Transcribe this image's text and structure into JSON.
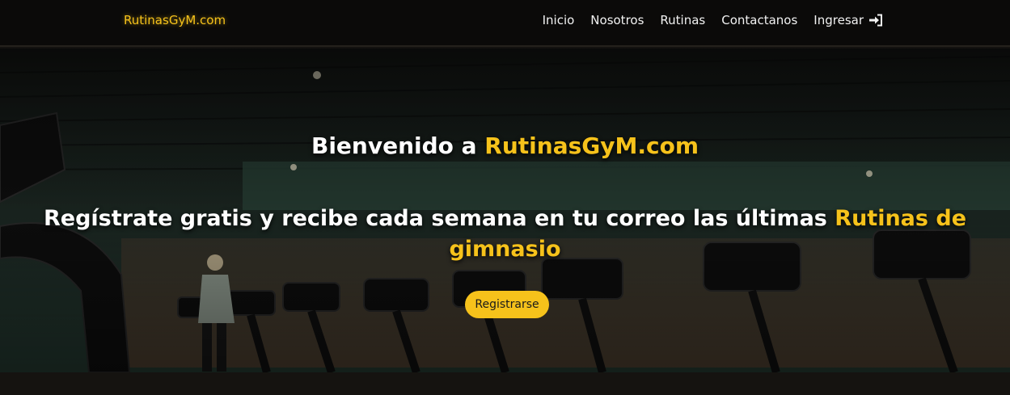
{
  "navbar": {
    "brand": "RutinasGyM.com",
    "links": [
      {
        "label": "Inicio"
      },
      {
        "label": "Nosotros"
      },
      {
        "label": "Rutinas"
      },
      {
        "label": "Contactanos"
      },
      {
        "label": "Ingresar",
        "icon": "login-icon"
      }
    ]
  },
  "hero": {
    "welcome_prefix": "Bienvenido a ",
    "welcome_brand": "RutinasGyM.com",
    "tagline_text": "Regístrate gratis y recibe cada semana en tu correo las últimas ",
    "tagline_highlight": "Rutinas de gimnasio",
    "cta_label": "Registrarse",
    "background_image": "gym-treadmills-photo"
  },
  "colors": {
    "accent": "#f6c21b",
    "navbar_bg": "#0b0a09",
    "text": "#ffffff"
  }
}
